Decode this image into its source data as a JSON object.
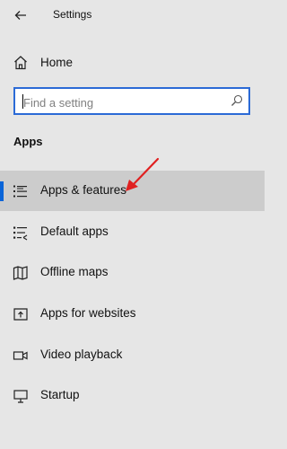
{
  "header": {
    "title": "Settings",
    "back_icon": "arrow-left-icon"
  },
  "home": {
    "label": "Home",
    "icon": "home-icon"
  },
  "search": {
    "placeholder": "Find a setting",
    "icon": "search-icon"
  },
  "section": {
    "heading": "Apps"
  },
  "nav": {
    "items": [
      {
        "label": "Apps & features",
        "icon": "apps-list-icon",
        "selected": true
      },
      {
        "label": "Default apps",
        "icon": "default-apps-icon",
        "selected": false
      },
      {
        "label": "Offline maps",
        "icon": "map-icon",
        "selected": false
      },
      {
        "label": "Apps for websites",
        "icon": "open-external-icon",
        "selected": false
      },
      {
        "label": "Video playback",
        "icon": "video-camera-icon",
        "selected": false
      },
      {
        "label": "Startup",
        "icon": "startup-icon",
        "selected": false
      }
    ]
  },
  "colors": {
    "background": "#e6e6e6",
    "selected_background": "#cccccc",
    "accent": "#0a64d8",
    "search_border": "#2b6ad6",
    "annotation_arrow": "#e02020"
  }
}
